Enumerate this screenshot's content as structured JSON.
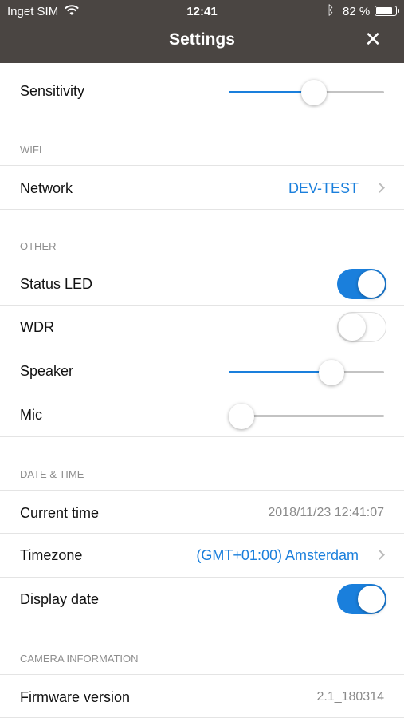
{
  "status_bar": {
    "carrier": "Inget SIM",
    "time": "12:41",
    "battery_text": "82 %",
    "battery_level": 0.82,
    "icons": [
      "wifi-icon",
      "bluetooth-icon",
      "battery-icon"
    ]
  },
  "header": {
    "title": "Settings",
    "close_label": "✕",
    "background": "#4a4542"
  },
  "accent_color": "#1a7fdc",
  "settings": {
    "sensitivity": {
      "label": "Sensitivity",
      "value_percent": 55
    },
    "wifi": {
      "header": "WIFI",
      "network": {
        "label": "Network",
        "value": "DEV-TEST"
      }
    },
    "other": {
      "header": "OTHER",
      "status_led": {
        "label": "Status LED",
        "on": true
      },
      "wdr": {
        "label": "WDR",
        "on": false
      },
      "speaker": {
        "label": "Speaker",
        "value_percent": 66
      },
      "mic": {
        "label": "Mic",
        "value_percent": 8
      }
    },
    "date_time": {
      "header": "DATE & TIME",
      "current_time": {
        "label": "Current time",
        "value": "2018/11/23 12:41:07"
      },
      "timezone": {
        "label": "Timezone",
        "value": "(GMT+01:00) Amsterdam"
      },
      "display_date": {
        "label": "Display date",
        "on": true
      }
    },
    "camera_info": {
      "header": "CAMERA INFORMATION",
      "firmware": {
        "label": "Firmware version",
        "value": "2.1_180314"
      }
    }
  }
}
